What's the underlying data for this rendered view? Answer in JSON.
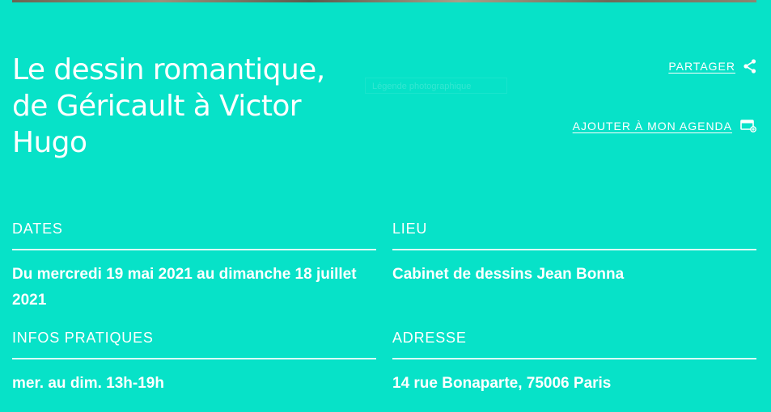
{
  "event": {
    "title": "Le dessin romantique, de Géricault à Victor Hugo",
    "ghost_tag": "Légende photographique"
  },
  "actions": {
    "share_label": "PARTAGER",
    "share_icon": "share-icon",
    "agenda_label": "AJOUTER À MON AGENDA",
    "agenda_icon": "calendar-add-icon"
  },
  "info": {
    "dates": {
      "heading": "DATES",
      "value": "Du mercredi 19 mai 2021 au dimanche 18 juillet 2021"
    },
    "lieu": {
      "heading": "LIEU",
      "value": "Cabinet de dessins Jean Bonna"
    },
    "infos_pratiques": {
      "heading": "INFOS PRATIQUES",
      "value": "mer. au dim. 13h-19h"
    },
    "adresse": {
      "heading": "ADRESSE",
      "value": "14 rue Bonaparte, 75006 Paris"
    }
  },
  "colors": {
    "background": "#07e2c8",
    "text": "#ffffff"
  }
}
